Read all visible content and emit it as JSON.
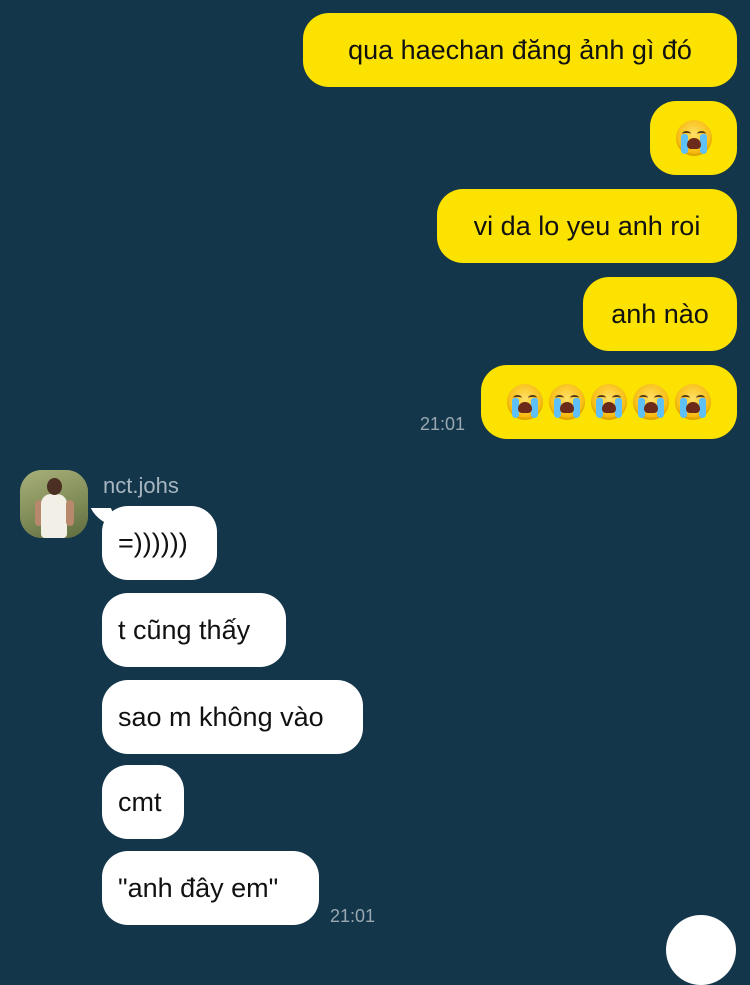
{
  "chat": {
    "outgoing": [
      {
        "text": "qua haechan đăng ảnh gì đó"
      },
      {
        "emoji": "loudly-crying-face",
        "count": 1
      },
      {
        "text": "vi da lo yeu anh roi"
      },
      {
        "text": "anh nào"
      },
      {
        "emoji": "loudly-crying-face",
        "count": 5
      }
    ],
    "outgoing_time": "21:01",
    "sender": {
      "name": "nct.johs"
    },
    "incoming": [
      {
        "text": "=))))))"
      },
      {
        "text": "t cũng thấy"
      },
      {
        "text": "sao m không vào"
      },
      {
        "text": "cmt"
      },
      {
        "text": "\"anh đây em\""
      }
    ],
    "incoming_time": "21:01"
  },
  "colors": {
    "background": "#14364a",
    "outgoing_bubble": "#fbe201",
    "incoming_bubble": "#ffffff",
    "timestamp": "#9aa8b2",
    "sender_name": "#a7b6c1"
  }
}
